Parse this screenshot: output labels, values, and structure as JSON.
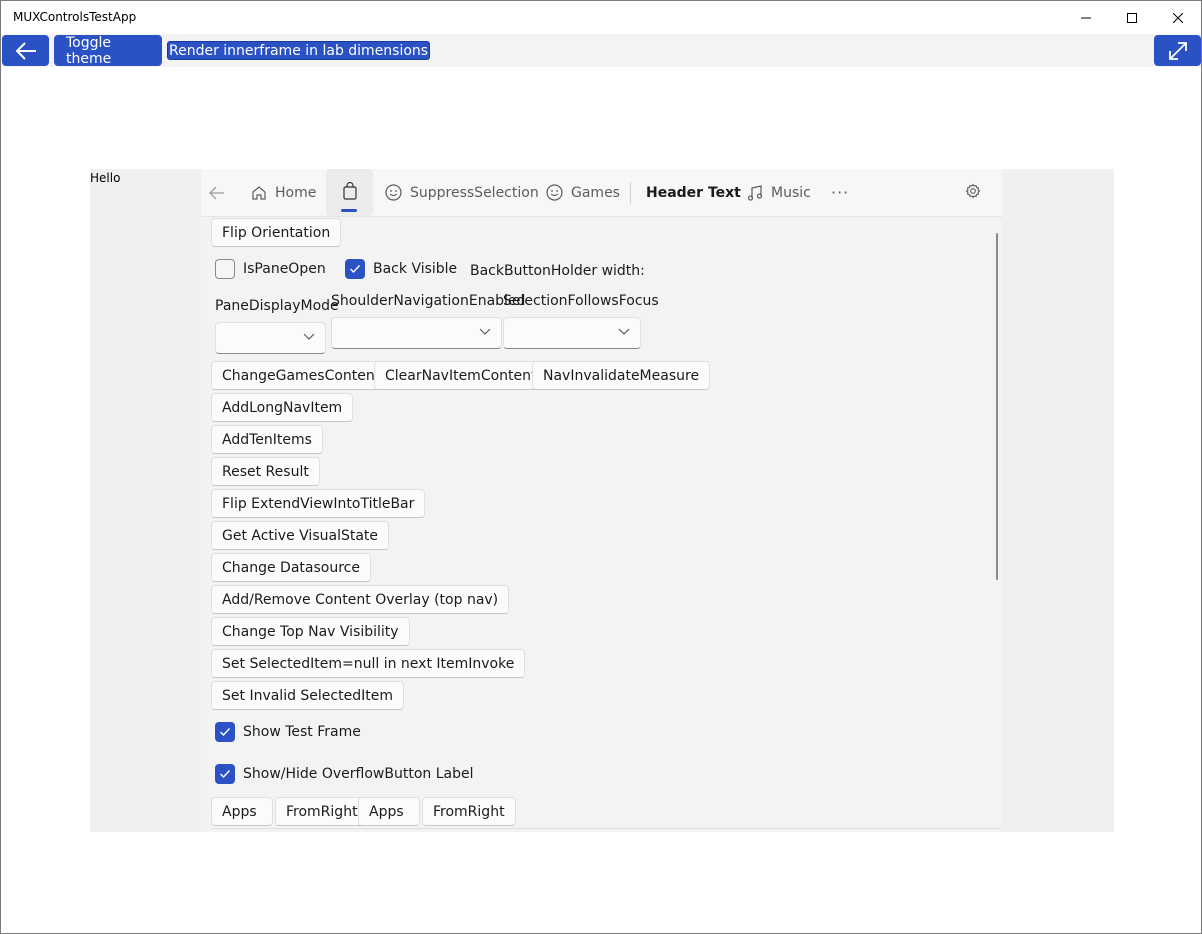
{
  "window": {
    "title": "MUXControlsTestApp"
  },
  "toolbar": {
    "toggle_theme": "Toggle theme",
    "render_innerframe": "Render innerframe in lab dimensions"
  },
  "frame": {
    "hello": "Hello"
  },
  "topnav": {
    "items": [
      {
        "label": "Home",
        "icon": "home-icon"
      },
      {
        "label": "",
        "icon": "shopping-bag-icon",
        "selected": true
      },
      {
        "label": "SuppressSelection",
        "icon": "emoji-icon"
      },
      {
        "label": "Games",
        "icon": "emoji-icon"
      }
    ],
    "header": "Header Text",
    "music": "Music",
    "more": "···"
  },
  "controls": {
    "flip_orientation": "Flip Orientation",
    "is_pane_open": "IsPaneOpen",
    "back_visible": "Back Visible",
    "back_button_holder_width": "BackButtonHolder width:",
    "pane_display_mode": "PaneDisplayMode",
    "shoulder_navigation_enabled": "ShoulderNavigationEnabled",
    "selection_follows_focus": "SelectionFollowsFocus",
    "change_games_content": "ChangeGamesContent",
    "clear_nav_item_content": "ClearNavItemContent",
    "nav_invalidate_measure": "NavInvalidateMeasure",
    "add_long_nav_item": "AddLongNavItem",
    "add_ten_items": "AddTenItems",
    "reset_result": "Reset Result",
    "flip_extend_view": "Flip ExtendViewIntoTitleBar",
    "get_active_visual_state": "Get Active VisualState",
    "change_datasource": "Change Datasource",
    "add_remove_content_overlay": "Add/Remove Content Overlay (top nav)",
    "change_top_nav_visibility": "Change Top Nav Visibility",
    "set_selected_item_null": "Set SelectedItem=null in next ItemInvoke",
    "set_invalid_selected_item": "Set Invalid SelectedItem",
    "show_test_frame": "Show Test Frame",
    "show_hide_overflow_label": "Show/Hide OverflowButton Label",
    "apps_1": "Apps",
    "from_right_1": "FromRight",
    "apps_2": "Apps",
    "from_right_2": "FromRight"
  },
  "checkbox_states": {
    "is_pane_open": false,
    "back_visible": true,
    "show_test_frame": true,
    "show_hide_overflow_label": true
  },
  "colors": {
    "accent": "#2b52c4",
    "frame_bg": "#f0f0f0"
  }
}
